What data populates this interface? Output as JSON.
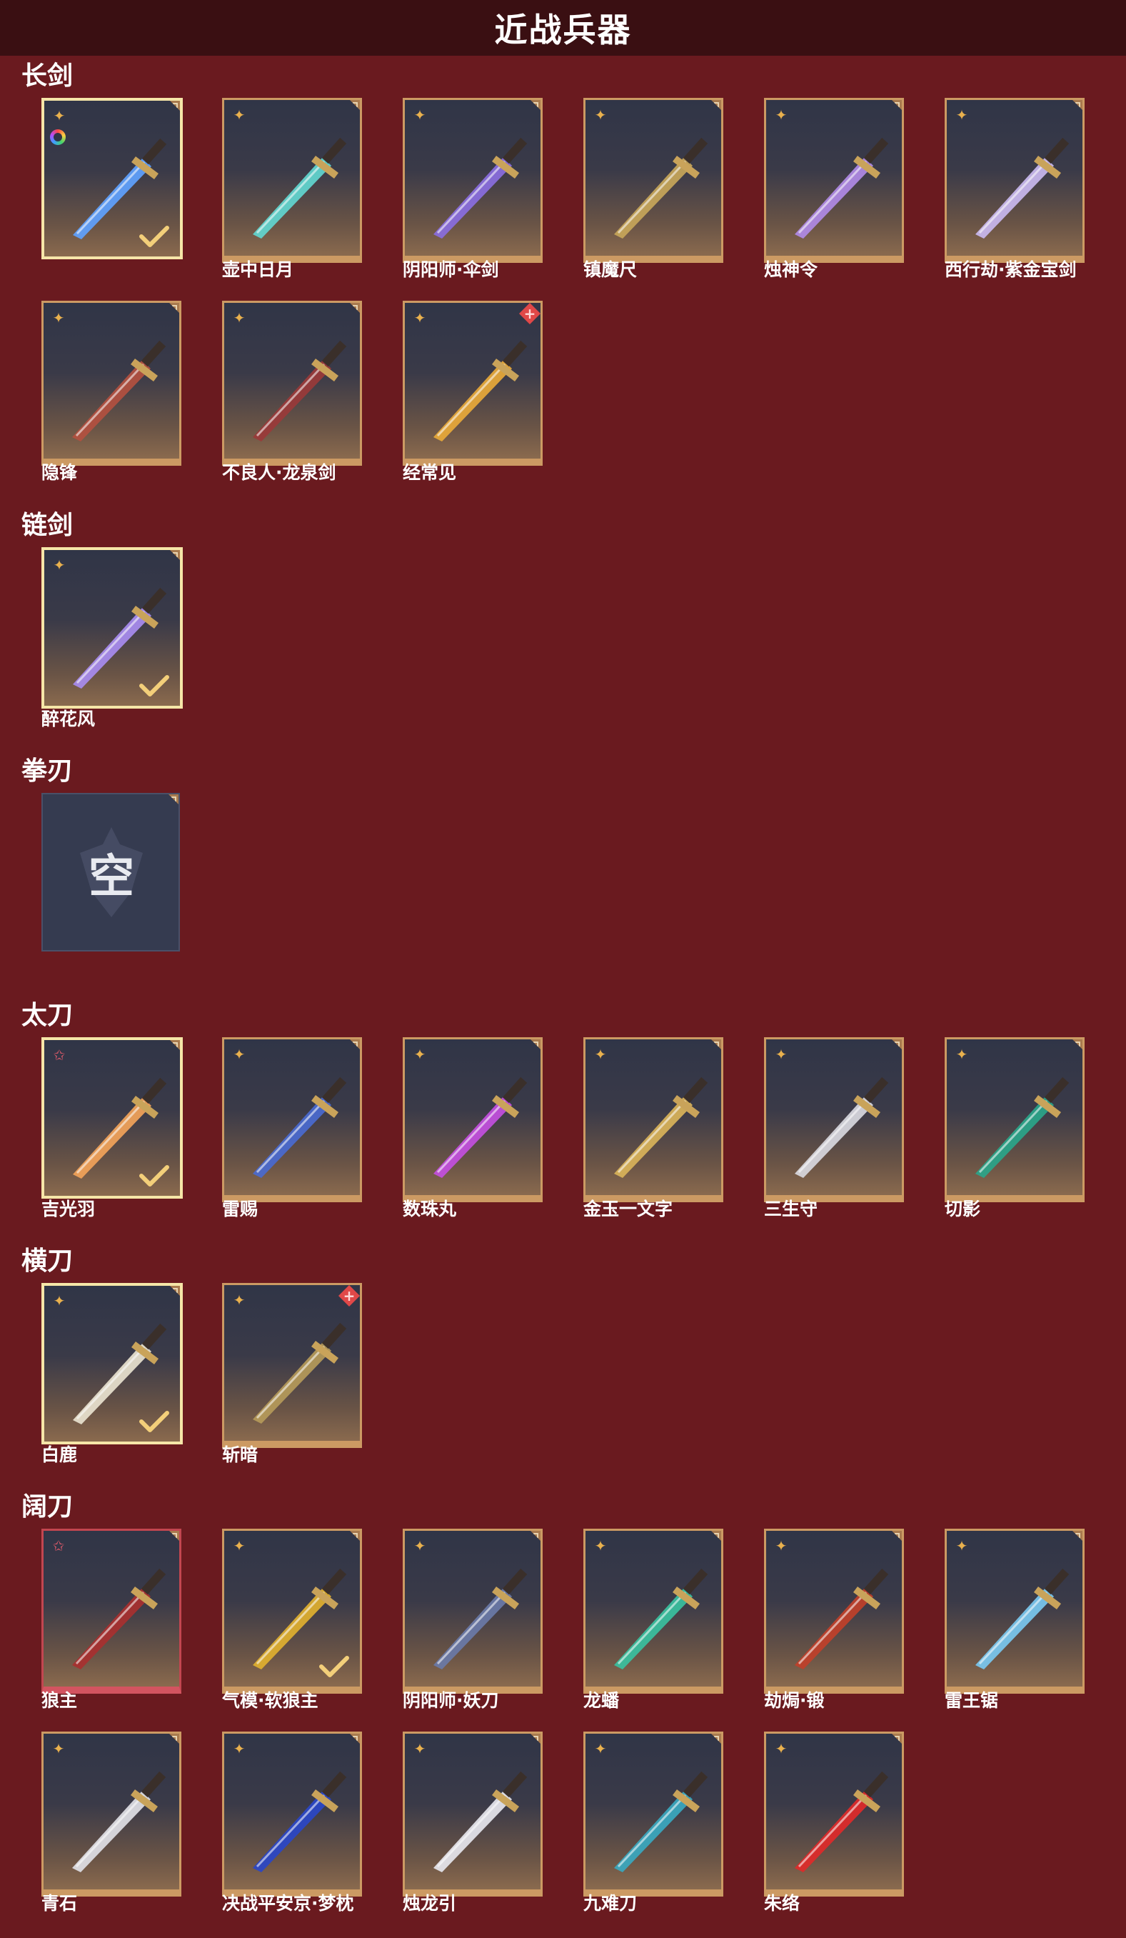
{
  "title": "近战兵器",
  "colors": {
    "background": "#6a1a1f",
    "header": "#3a0f12",
    "card_frame": "#cc9a63",
    "selected_frame": "#f6e6a8",
    "rarity_gold": "#e9b14e",
    "rarity_red": "#e35b6a"
  },
  "sections": [
    {
      "title": "长剑",
      "items": [
        {
          "name": "",
          "selected": true,
          "rarity": "gold",
          "ring": true,
          "color": "#5fa2ff"
        },
        {
          "name": "壶中日月",
          "rarity": "gold",
          "color": "#62d6d0"
        },
        {
          "name": "阴阳师·伞剑",
          "rarity": "gold",
          "color": "#8a6ee0"
        },
        {
          "name": "镇魔尺",
          "rarity": "gold",
          "color": "#c7a65a"
        },
        {
          "name": "烛神令",
          "rarity": "gold",
          "color": "#b08ae6"
        },
        {
          "name": "西行劫·紫金宝剑",
          "rarity": "gold",
          "color": "#c9b8f0"
        },
        {
          "name": "隐锋",
          "rarity": "gold",
          "color": "#b35040"
        },
        {
          "name": "不良人·龙泉剑",
          "rarity": "gold",
          "color": "#9a3a3a"
        },
        {
          "name": "经常见",
          "rarity": "gold",
          "plus": true,
          "color": "#e8a93a"
        }
      ]
    },
    {
      "title": "链剑",
      "items": [
        {
          "name": "醉花风",
          "selected": true,
          "rarity": "gold",
          "color": "#a88cf0"
        }
      ]
    },
    {
      "title": "拳刃",
      "items": [
        {
          "name": "",
          "empty": true,
          "empty_label": "空"
        }
      ]
    },
    {
      "title": "太刀",
      "items": [
        {
          "name": "吉光羽",
          "selected": true,
          "rarity": "red",
          "color": "#f2a35a"
        },
        {
          "name": "雷赐",
          "rarity": "gold",
          "color": "#4a6ad0"
        },
        {
          "name": "数珠丸",
          "rarity": "gold",
          "color": "#c34fe0"
        },
        {
          "name": "金玉一文字",
          "rarity": "gold",
          "color": "#d9b35a"
        },
        {
          "name": "三生守",
          "rarity": "gold",
          "color": "#d8d8e0"
        },
        {
          "name": "切影",
          "rarity": "gold",
          "color": "#2aa58a"
        }
      ]
    },
    {
      "title": "横刀",
      "items": [
        {
          "name": "白鹿",
          "selected": true,
          "rarity": "gold",
          "color": "#e8e2cf"
        },
        {
          "name": "斩暗",
          "rarity": "gold",
          "plus": true,
          "color": "#b59a5a"
        }
      ]
    },
    {
      "title": "阔刀",
      "items": [
        {
          "name": "狼主",
          "rarity": "red",
          "red_frame": true,
          "color": "#a83030"
        },
        {
          "name": "气模·软狼主",
          "rarity": "gold",
          "checked": true,
          "color": "#e0b030"
        },
        {
          "name": "阴阳师·妖刀",
          "rarity": "gold",
          "color": "#6a7aa8"
        },
        {
          "name": "龙蟠",
          "rarity": "gold",
          "color": "#3ac0a0"
        },
        {
          "name": "劫焗·锻",
          "rarity": "gold",
          "color": "#c0402a"
        },
        {
          "name": "雷王锯",
          "rarity": "gold",
          "color": "#7ac8f0"
        },
        {
          "name": "青石",
          "rarity": "gold",
          "color": "#e0e0e6"
        },
        {
          "name": "决战平安京·梦枕",
          "rarity": "gold",
          "color": "#2a46c8"
        },
        {
          "name": "烛龙引",
          "rarity": "gold",
          "color": "#e6e6ee"
        },
        {
          "name": "九难刀",
          "rarity": "gold",
          "color": "#3aa8c0"
        },
        {
          "name": "朱络",
          "rarity": "gold",
          "color": "#e02a2a"
        }
      ]
    }
  ]
}
